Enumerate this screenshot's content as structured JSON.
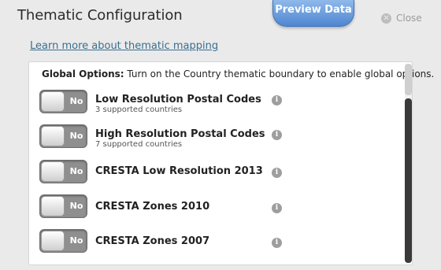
{
  "dialog": {
    "title": "Thematic Configuration",
    "preview_label": "Preview Data",
    "close_label": "Close",
    "learn_link": "Learn more about thematic mapping"
  },
  "global_options": {
    "label": "Global Options:",
    "text": " Turn on the Country thematic boundary to enable global options."
  },
  "rows": [
    {
      "toggle": "No",
      "label": "Low Resolution Postal Codes",
      "sub": "3 supported countries",
      "info": "i"
    },
    {
      "toggle": "No",
      "label": "High Resolution Postal Codes",
      "sub": "7 supported countries",
      "info": "i"
    },
    {
      "toggle": "No",
      "label": "CRESTA Low Resolution 2013",
      "sub": "",
      "info": "i"
    },
    {
      "toggle": "No",
      "label": "CRESTA Zones 2010",
      "sub": "",
      "info": "i"
    },
    {
      "toggle": "No",
      "label": "CRESTA Zones 2007",
      "sub": "",
      "info": "i"
    }
  ],
  "colors": {
    "preview_button": "#5b90d6",
    "link": "#3a6e8f",
    "toggle_off": "#8f8f8f"
  },
  "icons": {
    "close": "close-icon",
    "info": "info-icon"
  }
}
